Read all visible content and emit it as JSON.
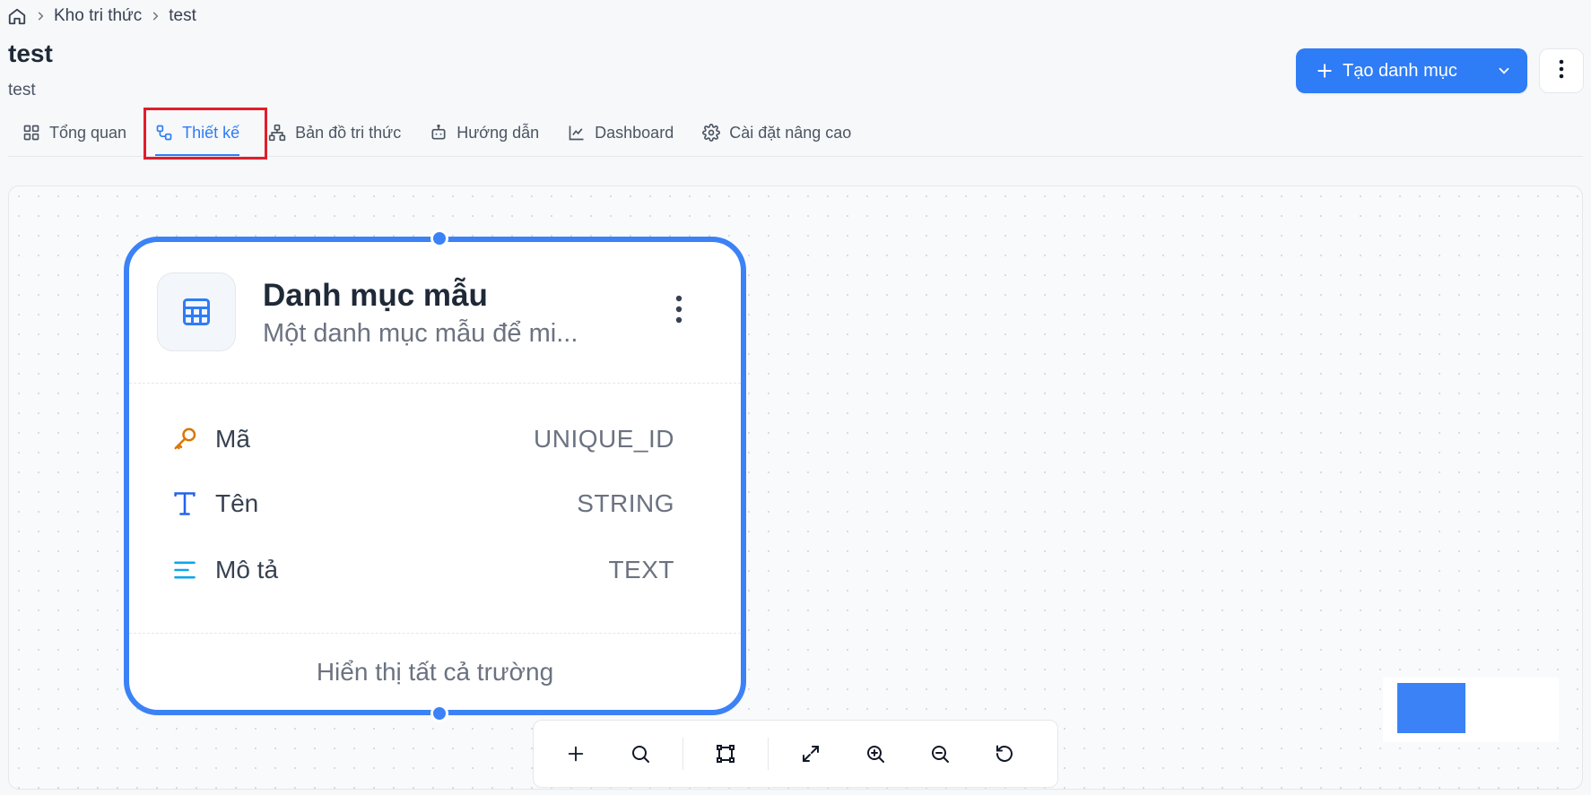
{
  "breadcrumb": {
    "items": [
      "Kho tri thức",
      "test"
    ]
  },
  "header": {
    "title": "test",
    "subtitle": "test",
    "create_label": "Tạo danh mục"
  },
  "tabs": [
    {
      "label": "Tổng quan",
      "icon": "grid-icon",
      "active": false
    },
    {
      "label": "Thiết kế",
      "icon": "design-nodes-icon",
      "active": true
    },
    {
      "label": "Bản đồ tri thức",
      "icon": "sitemap-icon",
      "active": false
    },
    {
      "label": "Hướng dẫn",
      "icon": "bot-icon",
      "active": false
    },
    {
      "label": "Dashboard",
      "icon": "line-chart-icon",
      "active": false
    },
    {
      "label": "Cài đặt nâng cao",
      "icon": "gear-icon",
      "active": false
    }
  ],
  "node": {
    "title": "Danh mục mẫu",
    "description": "Một danh mục mẫu để mi...",
    "fields": [
      {
        "name": "Mã",
        "type": "UNIQUE_ID",
        "icon": "key-icon"
      },
      {
        "name": "Tên",
        "type": "STRING",
        "icon": "text-type-icon"
      },
      {
        "name": "Mô tả",
        "type": "TEXT",
        "icon": "align-left-icon"
      }
    ],
    "footer": "Hiển thị tất cả trường"
  },
  "colors": {
    "accent": "#2e7cf6",
    "node_border": "#3b82f6",
    "highlight": "#e11d2a",
    "key_icon": "#d97706"
  }
}
